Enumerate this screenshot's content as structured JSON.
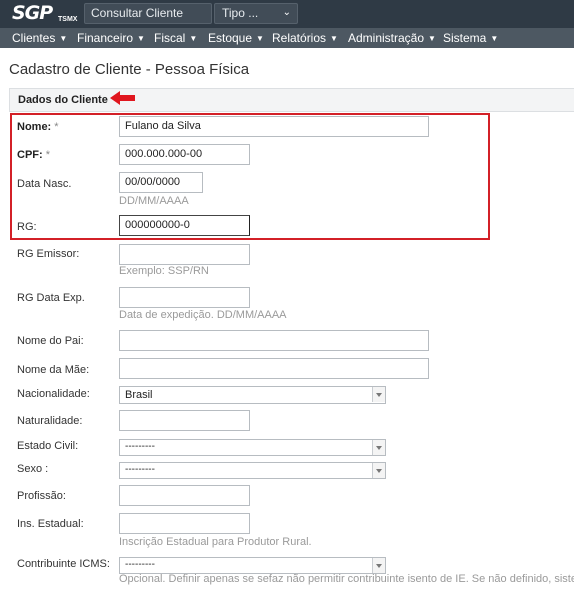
{
  "header": {
    "logo_text": "SGP",
    "logo_sub": "TSMX",
    "search_value": "Consultar Cliente",
    "type_select": "Tipo ...",
    "type_chevron": "⌄"
  },
  "menu": [
    {
      "label": "Clientes"
    },
    {
      "label": "Financeiro"
    },
    {
      "label": "Fiscal"
    },
    {
      "label": "Estoque"
    },
    {
      "label": "Relatórios"
    },
    {
      "label": "Administração"
    },
    {
      "label": "Sistema"
    }
  ],
  "menu_caret": "▼",
  "page_title": "Cadastro de Cliente - Pessoa Física",
  "section_title": "Dados do Cliente",
  "required_mark": "*",
  "fields": {
    "nome": {
      "label": "Nome:",
      "value": "Fulano da Silva"
    },
    "cpf": {
      "label": "CPF:",
      "value": "000.000.000-00"
    },
    "data_nasc": {
      "label": "Data Nasc.",
      "value": "00/00/0000",
      "help": "DD/MM/AAAA"
    },
    "rg": {
      "label": "RG:",
      "value": "000000000-0"
    },
    "rg_emissor": {
      "label": "RG Emissor:",
      "value": "",
      "help": "Exemplo: SSP/RN"
    },
    "rg_data_exp": {
      "label": "RG Data Exp.",
      "value": "",
      "help": "Data de expedição. DD/MM/AAAA"
    },
    "nome_pai": {
      "label": "Nome do Pai:",
      "value": ""
    },
    "nome_mae": {
      "label": "Nome da Mãe:",
      "value": ""
    },
    "nacionalidade": {
      "label": "Nacionalidade:",
      "value": "Brasil"
    },
    "naturalidade": {
      "label": "Naturalidade:",
      "value": ""
    },
    "estado_civil": {
      "label": "Estado Civil:",
      "value": "---------"
    },
    "sexo": {
      "label": "Sexo :",
      "value": "---------"
    },
    "profissao": {
      "label": "Profissão:",
      "value": ""
    },
    "ins_estadual": {
      "label": "Ins. Estadual:",
      "value": "",
      "help": "Inscrição Estadual para Produtor Rural."
    },
    "contribuinte_icms": {
      "label": "Contribuinte ICMS:",
      "value": "---------",
      "help": "Opcional. Definir apenas se sefaz não permitir contribuinte isento de IE. Se não definido, sistema"
    }
  },
  "colors": {
    "topbar": "#2f3a45",
    "menubar": "#4d5862",
    "highlight": "#d32027",
    "arrow": "#e0161e"
  }
}
